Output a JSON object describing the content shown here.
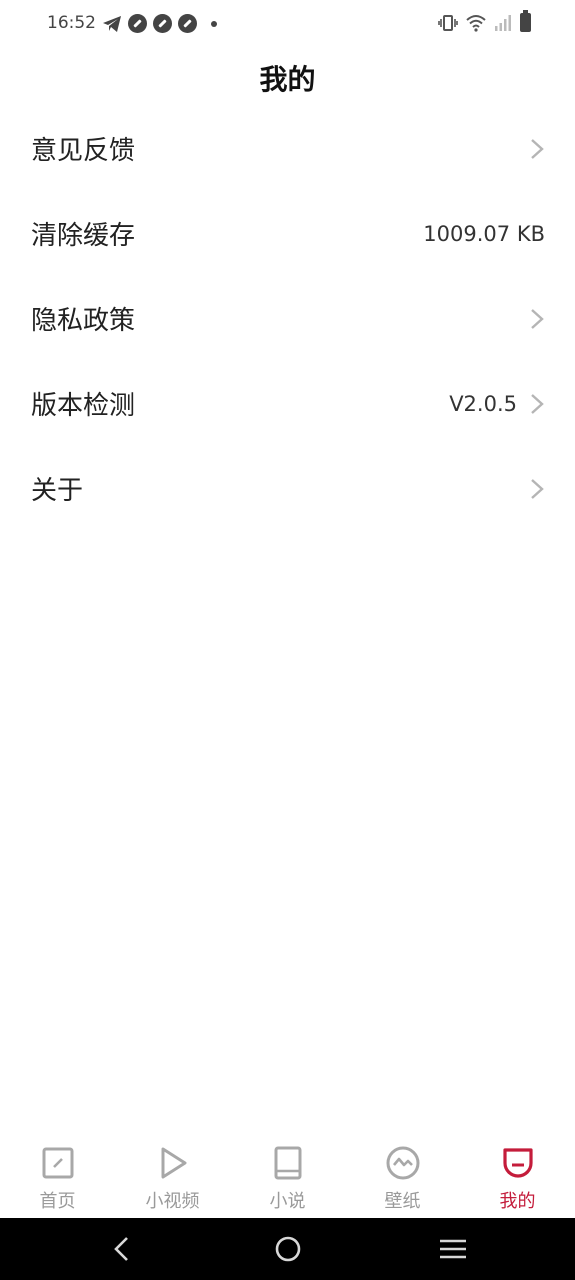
{
  "status_bar": {
    "time": "16:52",
    "left_icons": [
      "telegram-icon",
      "app-circle-icon",
      "app-circle-icon",
      "app-circle-icon",
      "notification-dot-icon"
    ],
    "right_icons": [
      "vibrate-icon",
      "wifi-icon",
      "signal-icon",
      "battery-icon"
    ]
  },
  "header": {
    "title": "我的"
  },
  "menu": {
    "items": [
      {
        "label": "意见反馈",
        "value": "",
        "chevron": true
      },
      {
        "label": "清除缓存",
        "value": "1009.07 KB",
        "chevron": false
      },
      {
        "label": "隐私政策",
        "value": "",
        "chevron": true
      },
      {
        "label": "版本检测",
        "value": "V2.0.5",
        "chevron": true
      },
      {
        "label": "关于",
        "value": "",
        "chevron": true
      }
    ]
  },
  "tab_bar": {
    "tabs": [
      {
        "label": "首页",
        "icon": "home-icon",
        "active": false
      },
      {
        "label": "小视频",
        "icon": "play-icon",
        "active": false
      },
      {
        "label": "小说",
        "icon": "book-icon",
        "active": false
      },
      {
        "label": "壁纸",
        "icon": "wallpaper-icon",
        "active": false
      },
      {
        "label": "我的",
        "icon": "profile-icon",
        "active": true
      }
    ]
  },
  "colors": {
    "accent": "#c41c3b",
    "inactive": "#9a9a9a",
    "nav_bar": "#000000"
  }
}
